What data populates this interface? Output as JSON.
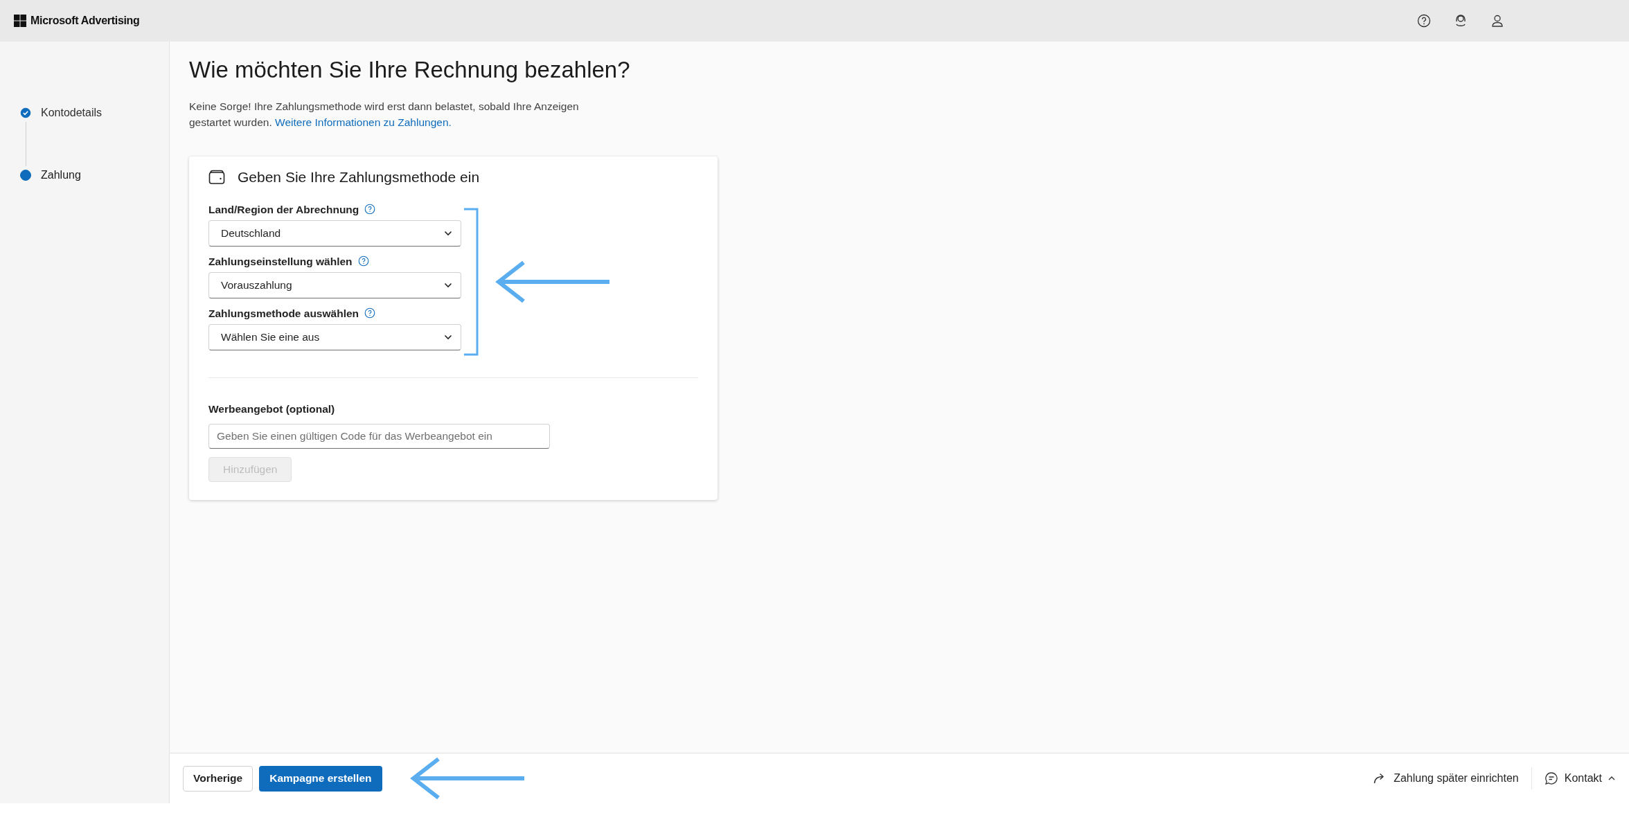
{
  "header": {
    "brand": "Microsoft Advertising"
  },
  "sidebar": {
    "steps": [
      {
        "label": "Kontodetails",
        "completed": true,
        "selected": false
      },
      {
        "label": "Zahlung",
        "completed": false,
        "selected": true
      }
    ]
  },
  "page": {
    "title": "Wie möchten Sie Ihre Rechnung bezahlen?",
    "intro": "Keine Sorge! Ihre Zahlungsmethode wird erst dann belastet, sobald Ihre Anzeigen gestartet wurden.",
    "link": "Weitere Informationen zu Zahlungen."
  },
  "card": {
    "title": "Geben Sie Ihre Zahlungsmethode ein",
    "selects": [
      {
        "label": "Land/Region der Abrechnung",
        "value": "Deutschland"
      },
      {
        "label": "Zahlungseinstellung wählen",
        "value": "Vorauszahlung"
      },
      {
        "label": "Zahlungsmethode auswählen",
        "value": "Wählen Sie eine aus"
      }
    ],
    "promo": {
      "label": "Werbeangebot (optional)",
      "placeholder": "Geben Sie einen gültigen Code für das Werbeangebot ein",
      "button": "Hinzufügen",
      "disabled": true
    }
  },
  "footer": {
    "back": "Vorherige",
    "primary": "Kampagne erstellen",
    "later": "Zahlung später einrichten",
    "contact": "Kontakt",
    "contact_expanded": false
  }
}
